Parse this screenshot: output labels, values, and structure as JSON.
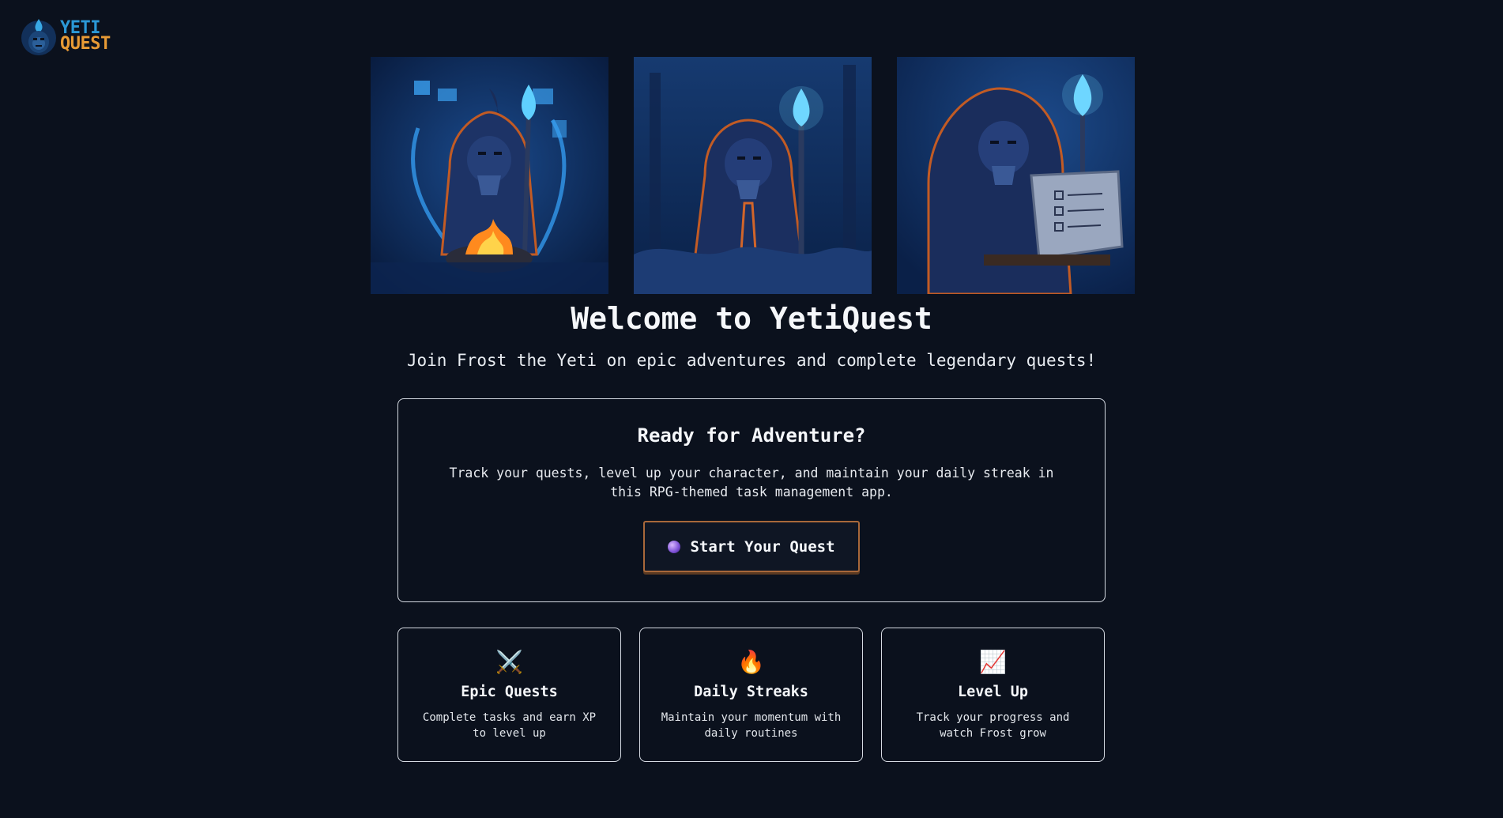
{
  "app": {
    "logo_line1": "YETI",
    "logo_line2": "QUEST"
  },
  "hero": {
    "images": [
      {
        "icon": "yeti-wizard-campfire-image"
      },
      {
        "icon": "yeti-wizard-staff-image"
      },
      {
        "icon": "yeti-wizard-scroll-image"
      }
    ]
  },
  "welcome": {
    "title": "Welcome to YetiQuest",
    "subtitle": "Join Frost the Yeti on epic adventures and complete legendary quests!"
  },
  "cta_card": {
    "title": "Ready for Adventure?",
    "description": "Track your quests, level up your character, and maintain your daily streak in this RPG-themed task management app.",
    "button_label": "Start Your Quest",
    "button_icon": "crystal-ball-icon"
  },
  "features": [
    {
      "icon_glyph": "⚔️",
      "title": "Epic Quests",
      "description": "Complete tasks and earn XP to level up"
    },
    {
      "icon_glyph": "🔥",
      "title": "Daily Streaks",
      "description": "Maintain your momentum with daily routines"
    },
    {
      "icon_glyph": "📈",
      "title": "Level Up",
      "description": "Track your progress and watch Frost grow"
    }
  ],
  "colors": {
    "background": "#0b111d",
    "logo_blue": "#2b98d6",
    "logo_orange": "#e79a35",
    "card_border": "#d5dae2",
    "button_border": "#a8683a"
  }
}
